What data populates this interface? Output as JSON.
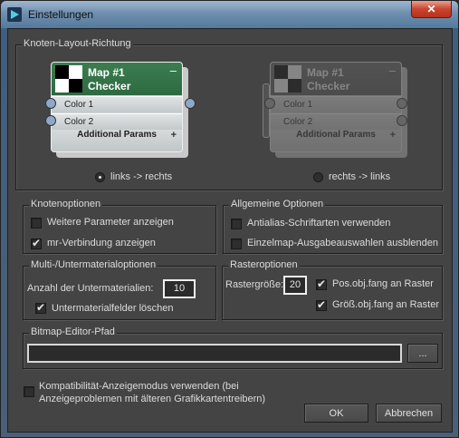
{
  "window": {
    "title": "Einstellungen",
    "close_glyph": "✕"
  },
  "layout_group": {
    "title": "Knoten-Layout-Richtung",
    "node": {
      "name_line1": "Map #1",
      "name_line2": "Checker",
      "collapse_glyph": "–",
      "slots": [
        "Color 1",
        "Color 2"
      ],
      "footer": "Additional Params",
      "footer_glyph": "+"
    },
    "options": [
      {
        "label": "links -> rechts",
        "selected": true
      },
      {
        "label": "rechts -> links",
        "selected": false
      }
    ]
  },
  "node_options": {
    "title": "Knotenoptionen",
    "items": [
      {
        "label": "Weitere Parameter anzeigen",
        "checked": false
      },
      {
        "label": "mr-Verbindung anzeigen",
        "checked": true
      }
    ]
  },
  "general_options": {
    "title": "Allgemeine Optionen",
    "items": [
      {
        "label": "Antialias-Schriftarten verwenden",
        "checked": false
      },
      {
        "label": "Einzelmap-Ausgabeauswahlen ausblenden",
        "checked": false
      }
    ]
  },
  "multi_sub": {
    "title": "Multi-/Untermaterialoptionen",
    "count_label": "Anzahl der Untermaterialien:",
    "count_value": "10",
    "delete_label": "Untermaterialfelder löschen",
    "delete_checked": true
  },
  "grid_options": {
    "title": "Rasteroptionen",
    "size_label": "Rastergröße:",
    "size_value": "20",
    "snap_pos_label": "Pos.obj.fang an Raster",
    "snap_pos_checked": true,
    "snap_size_label": "Größ.obj.fang an Raster",
    "snap_size_checked": true
  },
  "bitmap_path": {
    "title": "Bitmap-Editor-Pfad",
    "value": "",
    "browse_label": "..."
  },
  "compat": {
    "label_line1": "Kompatibilität-Anzeigemodus verwenden (bei",
    "label_line2": "Anzeigeproblemen mit älteren Grafikkartentreibern)",
    "checked": false
  },
  "buttons": {
    "ok": "OK",
    "cancel": "Abbrechen"
  }
}
